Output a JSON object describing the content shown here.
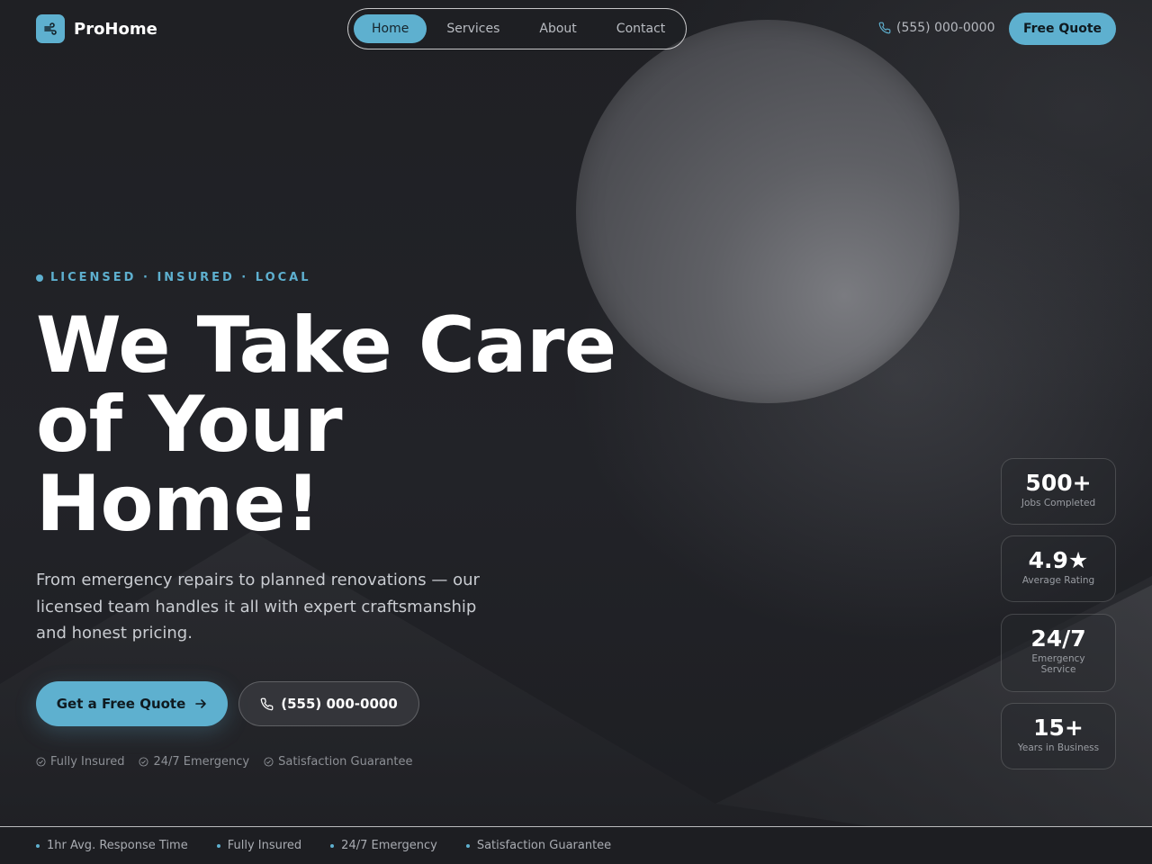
{
  "brand": {
    "name": "ProHome",
    "logo_icon": "wind-icon"
  },
  "nav": {
    "items": [
      {
        "label": "Home",
        "active": true
      },
      {
        "label": "Services",
        "active": false
      },
      {
        "label": "About",
        "active": false
      },
      {
        "label": "Contact",
        "active": false
      }
    ]
  },
  "header": {
    "phone": "(555) 000-0000",
    "quote_label": "Free Quote"
  },
  "hero": {
    "eyebrow": "LICENSED · INSURED · LOCAL",
    "headline_lines": [
      "We Take Care",
      "of Your",
      "Home!"
    ],
    "subtext": "From emergency repairs to planned renovations — our licensed team handles it all with expert craftsmanship and honest pricing.",
    "cta_primary": "Get a Free Quote",
    "cta_secondary": "(555) 000-0000",
    "trust": [
      "Fully Insured",
      "24/7 Emergency",
      "Satisfaction Guarantee"
    ]
  },
  "stats": [
    {
      "value": "500+",
      "label": "Jobs Completed"
    },
    {
      "value": "4.9★",
      "label": "Average Rating"
    },
    {
      "value": "24/7",
      "label": "Emergency Service"
    },
    {
      "value": "15+",
      "label": "Years in Business"
    }
  ],
  "strip": [
    "1hr Avg. Response Time",
    "Fully Insured",
    "24/7 Emergency",
    "Satisfaction Guarantee"
  ],
  "colors": {
    "accent": "#5eb0cf",
    "background": "#1f2024",
    "text": "#ffffff"
  }
}
